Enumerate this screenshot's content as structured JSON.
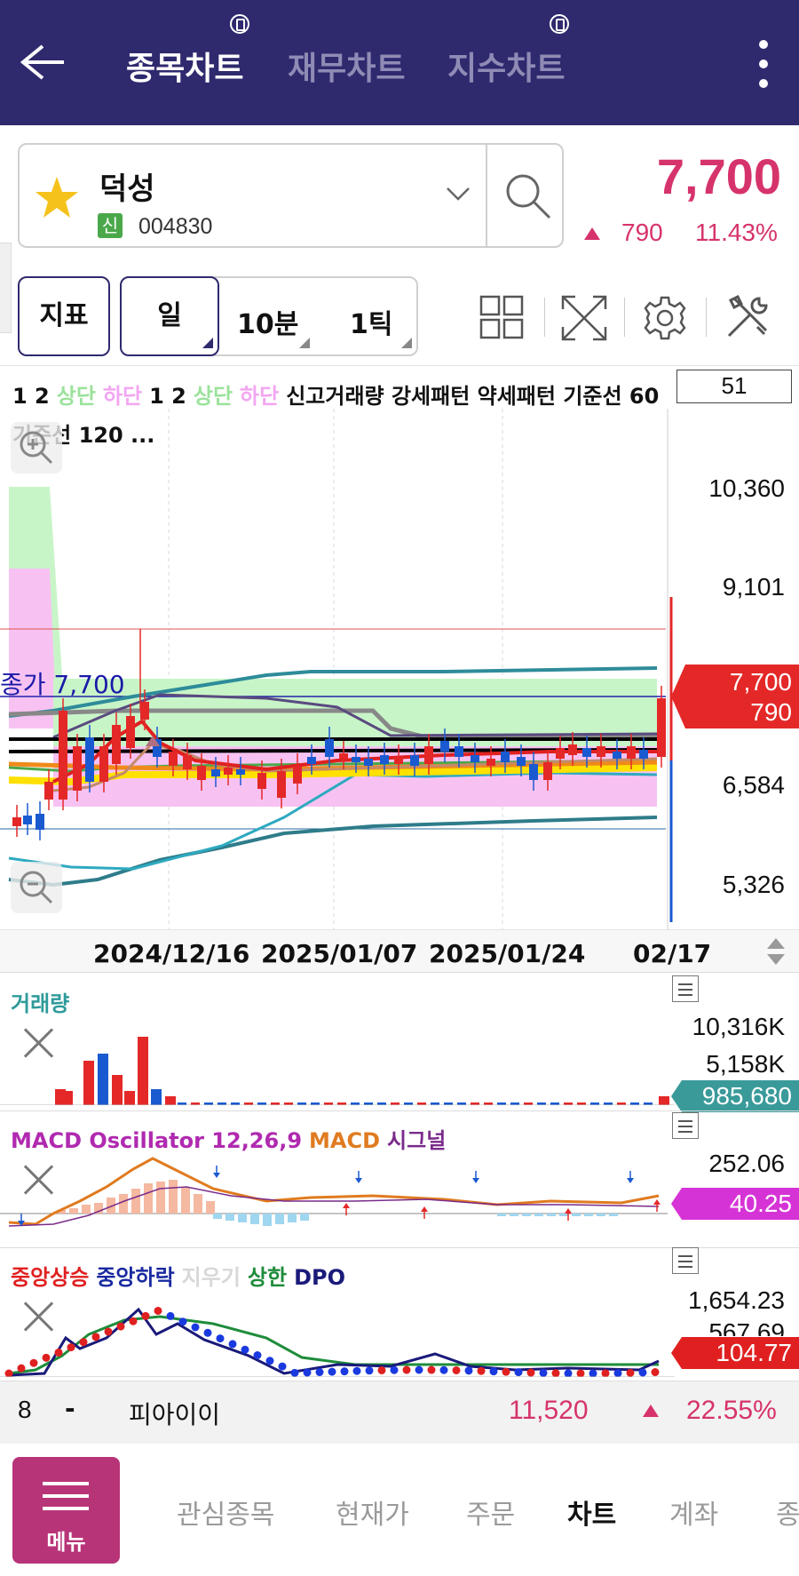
{
  "header": {
    "tabs": [
      {
        "label": "종목차트",
        "active": true
      },
      {
        "label": "재무차트",
        "active": false
      },
      {
        "label": "지수차트",
        "active": false
      }
    ]
  },
  "stock": {
    "name": "덕성",
    "badge": "신",
    "code": "004830",
    "price": "7,700",
    "change": "790",
    "change_pct": "11.43%",
    "up_color": "#d6336c"
  },
  "toolbar": {
    "indicator_label": "지표",
    "periods": [
      {
        "label": "일",
        "active": true
      },
      {
        "label": "10분",
        "active": false
      },
      {
        "label": "1틱",
        "active": false
      }
    ]
  },
  "main_chart": {
    "legend_line1": [
      {
        "text": "1 2",
        "color": "#111111"
      },
      {
        "text": "상단",
        "color": "#9be29b"
      },
      {
        "text": "하단",
        "color": "#f2a6f2"
      },
      {
        "text": "1 2",
        "color": "#111111"
      },
      {
        "text": "상단",
        "color": "#9be29b"
      },
      {
        "text": "하단",
        "color": "#f2a6f2"
      },
      {
        "text": "신고거래량 강세패턴 약세패턴 기준선 60",
        "color": "#111111"
      }
    ],
    "legend_line2": "기준선 120 ...",
    "period_value": "51",
    "y_ticks": [
      "10,360",
      "9,101",
      "6,584",
      "5,326"
    ],
    "close_label": "종가 7,700",
    "price_tag": "7,700",
    "change_tag": "790",
    "x_ticks": [
      "2024/12/16",
      "2025/01/07",
      "2025/01/24",
      "02/17"
    ]
  },
  "volume": {
    "title": "거래량",
    "ticks": [
      "10,316K",
      "5,158K"
    ],
    "current": "985,680",
    "tag_color": "#3a9a9a"
  },
  "macd": {
    "title_parts": [
      {
        "text": "MACD Oscillator 12,26,9",
        "color": "#b02ab0"
      },
      {
        "text": "MACD",
        "color": "#e07b20"
      },
      {
        "text": "시그널",
        "color": "#7a2a8a"
      }
    ],
    "tick": "252.06",
    "current": "40.25",
    "tag_color": "#d633d6"
  },
  "dpo": {
    "title_parts": [
      {
        "text": "중앙상승",
        "color": "#e02020"
      },
      {
        "text": "중앙하락",
        "color": "#1a2aa0"
      },
      {
        "text": "지우기",
        "color": "#d8d8d8"
      },
      {
        "text": "상한",
        "color": "#1e8c3a"
      },
      {
        "text": "DPO",
        "color": "#1a1a7a"
      }
    ],
    "ticks": [
      "1,654.23",
      "567.69"
    ],
    "current": "104.77",
    "tag_color": "#e02020"
  },
  "ticker": {
    "rank": "8",
    "dash": "-",
    "name": "피아이이",
    "price": "11,520",
    "change_pct": "22.55%"
  },
  "bottom_nav": {
    "menu_label": "메뉴",
    "items": [
      {
        "label": "관심종목",
        "active": false
      },
      {
        "label": "현재가",
        "active": false
      },
      {
        "label": "주문",
        "active": false
      },
      {
        "label": "차트",
        "active": true
      },
      {
        "label": "계좌",
        "active": false
      },
      {
        "label": "종",
        "active": false
      }
    ]
  }
}
